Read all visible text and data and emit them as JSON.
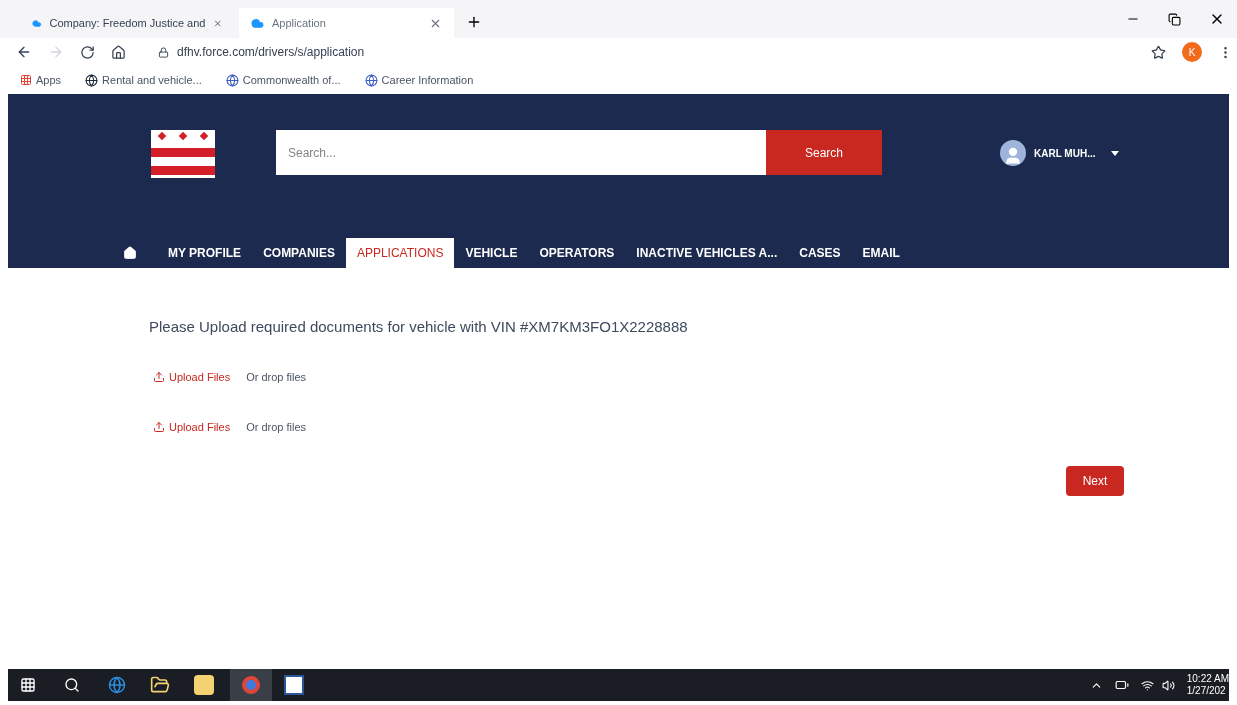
{
  "browser": {
    "tabs": [
      {
        "title": "Company: Freedom Justice and",
        "selected": false
      },
      {
        "title": "Application",
        "selected": true
      }
    ],
    "url": "dfhv.force.com/drivers/s/application",
    "profile_initial": "K",
    "bookmarks": [
      "Apps",
      "Rental and vehicle...",
      "Commonwealth of...",
      "Career Information"
    ]
  },
  "header": {
    "search": {
      "placeholder": "Search...",
      "button": "Search"
    },
    "user": "KARL MUH..."
  },
  "nav": [
    {
      "label": "MY PROFILE",
      "selected": false
    },
    {
      "label": "COMPANIES",
      "selected": false
    },
    {
      "label": "APPLICATIONS",
      "selected": true
    },
    {
      "label": "VEHICLE",
      "selected": false
    },
    {
      "label": "OPERATORS",
      "selected": false
    },
    {
      "label": "INACTIVE VEHICLES A...",
      "selected": false
    },
    {
      "label": "CASES",
      "selected": false
    },
    {
      "label": "EMAIL",
      "selected": false
    }
  ],
  "content": {
    "heading": "Please Upload required documents for vehicle with VIN #XM7KM3FO1X2228888",
    "uploads": [
      {
        "button": "Upload Files",
        "drop": "Or drop files"
      },
      {
        "button": "Upload Files",
        "drop": "Or drop files"
      }
    ],
    "next": "Next"
  },
  "taskbar": {
    "time": "10:22 AM",
    "date": "1/27/202"
  }
}
